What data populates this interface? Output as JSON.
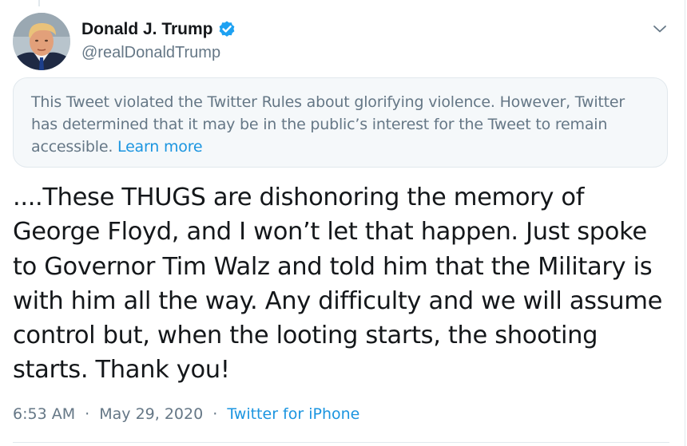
{
  "author": {
    "display_name": "Donald J. Trump",
    "handle": "@realDonaldTrump",
    "verified": true,
    "avatar_icon": "profile-photo"
  },
  "notice": {
    "text": "This Tweet violated the Twitter Rules about glorifying violence. However, Twitter has determined that it may be in the public’s interest for the Tweet to remain accessible.",
    "link_label": "Learn more"
  },
  "tweet": {
    "text": "....These THUGS are dishonoring the memory of George Floyd, and I won’t let that happen. Just spoke to Governor Tim Walz and told him that the Military is with him all the way. Any difficulty and we will assume control but, when the looting starts, the shooting starts. Thank you!"
  },
  "meta": {
    "time": "6:53 AM",
    "separator": "·",
    "date": "May 29, 2020",
    "source": "Twitter for iPhone"
  },
  "colors": {
    "link": "#1b95e0",
    "secondary_text": "#657786",
    "primary_text": "#14171a",
    "notice_bg": "#f5f8fa",
    "border": "#e1e8ed",
    "verified_badge": "#1da1f2"
  }
}
